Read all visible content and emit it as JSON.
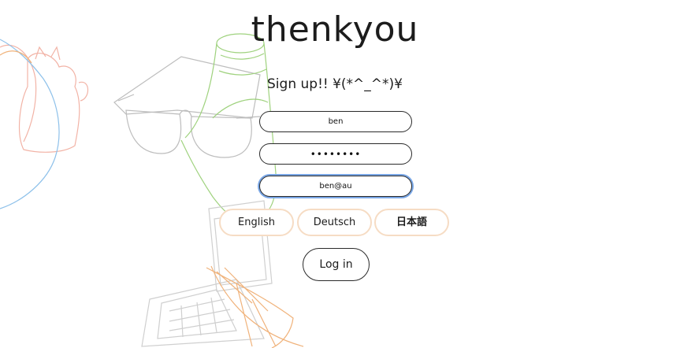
{
  "app": {
    "logo": "thenkyou"
  },
  "signup": {
    "heading": "Sign up!! ¥(*^_^*)¥"
  },
  "form": {
    "username_value": "ben",
    "password_value": "••••••••",
    "email_value": "ben@au"
  },
  "languages": [
    {
      "label": "English"
    },
    {
      "label": "Deutsch"
    },
    {
      "label": "日本語"
    }
  ],
  "actions": {
    "login_label": "Log in"
  },
  "colors": {
    "line_gray": "#c8c8c8",
    "line_green": "#9fd27e",
    "line_orange": "#f0b27a",
    "line_blue": "#8ec1ea",
    "line_pink": "#f2b3a6",
    "lang_border": "#f6dcc4",
    "focus_ring": "#7aa7e6"
  }
}
